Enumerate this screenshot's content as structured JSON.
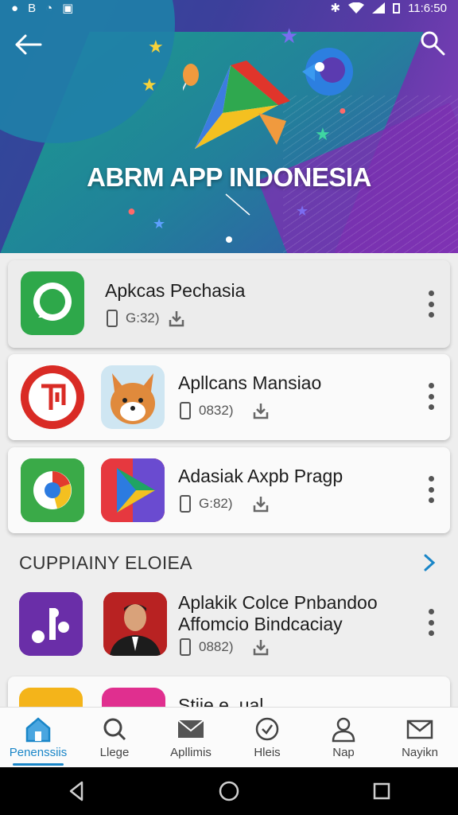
{
  "status_bar": {
    "left_icons": [
      "●",
      "B",
      "◔",
      "▣"
    ],
    "bluetooth": "✱",
    "time": "11:6:50"
  },
  "hero": {
    "title": "ABRM APP INDONESIA"
  },
  "featured": [
    {
      "name": "Apkcas Pechasia",
      "size": "G:32)"
    },
    {
      "name": "Apllcans Mansiao",
      "size": "0832)"
    },
    {
      "name": "Adasiak Axpb Pragp",
      "size": "G:82)"
    }
  ],
  "section": {
    "title": "CUPPIAINY ELOIEA",
    "item": {
      "name_line1": "Aplakik Colce Pnbandoo",
      "name_line2": "Affomcio Bindcaciay",
      "size": "0882)"
    },
    "partial_name": "Stiie e. ual"
  },
  "bottom_nav": [
    {
      "label": "Penenssiis",
      "icon": "home-icon"
    },
    {
      "label": "Llege",
      "icon": "search-icon"
    },
    {
      "label": "Apllimis",
      "icon": "mail-icon"
    },
    {
      "label": "Hleis",
      "icon": "clock-icon"
    },
    {
      "label": "Nap",
      "icon": "person-icon"
    },
    {
      "label": "Nayikn",
      "icon": "envelope-icon"
    }
  ],
  "colors": {
    "accent": "#1a86c8",
    "hero_start": "#2e4a9a",
    "hero_end": "#8b3fbf"
  }
}
